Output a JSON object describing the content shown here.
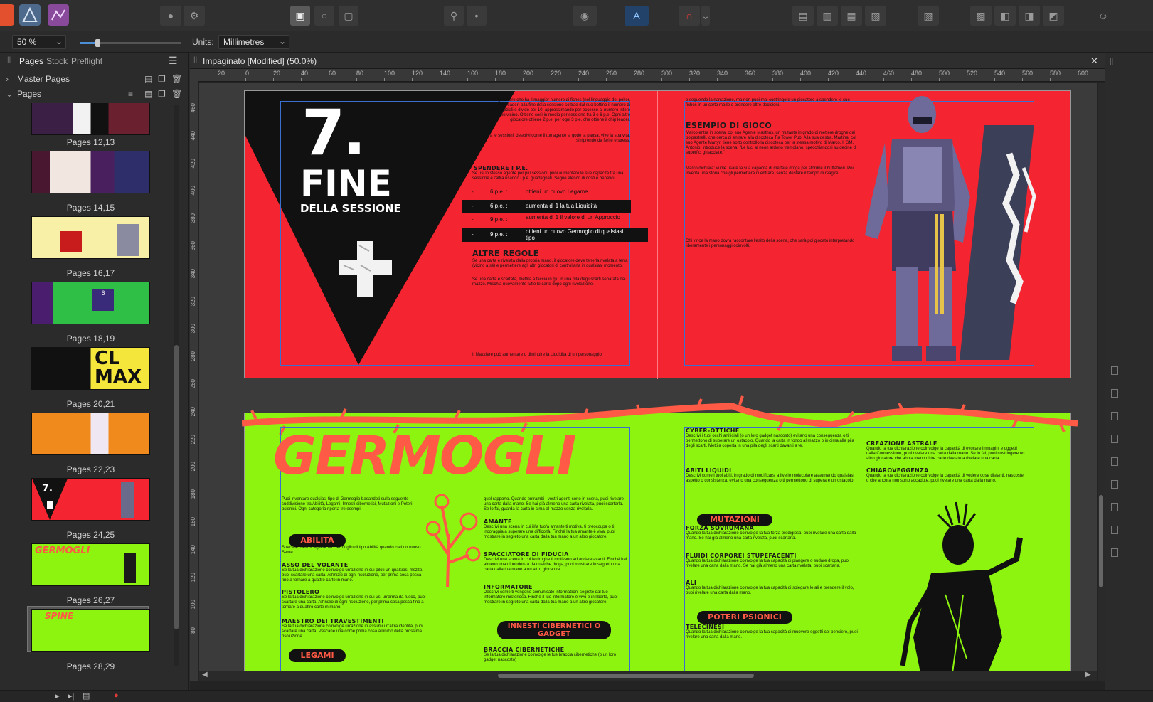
{
  "contextbar": {
    "zoom_value": "50 %",
    "units_label": "Units:",
    "units_value": "Millimetres"
  },
  "panel": {
    "tabs": [
      "Pages",
      "Stock",
      "Preflight"
    ],
    "master_pages_label": "Master Pages",
    "pages_label": "Pages",
    "thumbnails": [
      {
        "label": "Pages 12,13"
      },
      {
        "label": "Pages 14,15"
      },
      {
        "label": "Pages 16,17"
      },
      {
        "label": "Pages 18,19"
      },
      {
        "label": "Pages 20,21"
      },
      {
        "label": "Pages 22,23"
      },
      {
        "label": "Pages 24,25"
      },
      {
        "label": "Pages 26,27"
      },
      {
        "label": "Pages 28,29"
      }
    ]
  },
  "document": {
    "tab_title": "Impaginato [Modified] (50.0%)",
    "ruler_h": [
      "20",
      "0",
      "20",
      "40",
      "60",
      "80",
      "100",
      "120",
      "140",
      "160",
      "180",
      "200",
      "220",
      "240",
      "260",
      "280",
      "300",
      "320",
      "340",
      "360",
      "380",
      "400",
      "420",
      "440",
      "460",
      "480",
      "500",
      "520",
      "540",
      "560",
      "580",
      "600"
    ],
    "ruler_v": [
      "460",
      "440",
      "420",
      "400",
      "380",
      "360",
      "340",
      "320",
      "300",
      "280",
      "260",
      "240",
      "220",
      "200",
      "180",
      "160",
      "140",
      "120",
      "100",
      "80"
    ]
  },
  "spread1": {
    "big_number": "7.",
    "title_line1": "FINE",
    "title_line2": "DELLA SESSIONE",
    "intro_text": "Il giocatore che ha il maggior numero di fiches (nel linguaggio del poker, chip leader) alla fine della sessione sottrae dal suo bottino il numero di fiches iniziali e divide per 10, approssimando per eccesso al numero intero più vicino. Ottiene così in media per sessione tra 3 e 6 p.e. Ogni altro giocatore ottiene 2 p.e. per ogni 3 p.e. che ottiene il chip leader.",
    "intro_text2": "Tra le sessioni, descrivi come il tuo agente si gode la pausa, vive la sua vita, si riprende da ferite e stress.",
    "spend_heading": "SPENDERE I P.E.",
    "spend_text": "Se usi lo stesso agente per più sessioni, puoi aumentare le sue capacità tra una sessione e l'altra usando i p.e. guadagnati. Segue elenco di costi e benefici.",
    "costs": [
      {
        "cost": "6 p.e. :",
        "benefit": "ottieni un nuovo Legame"
      },
      {
        "cost": "6 p.e. :",
        "benefit": "aumenta di 1 la tua Liquidità"
      },
      {
        "cost": "9 p.e. :",
        "benefit": "aumenta di 1 il valore di un Approccio"
      },
      {
        "cost": "9 p.e. :",
        "benefit": "ottieni un nuovo Germoglio di qualsiasi tipo"
      }
    ],
    "altre_heading": "ALTRE REGOLE",
    "altre_text": "Se una carta è rivelata dalla propria mano, il giocatore deve tenerla rivelata a terra (vicino a sé) e permettere agli altri giocatori di controllarla in qualsiasi momento.",
    "altre_text2": "Se una carta è scartata, mettila a faccia in giù in una pila degli scarti separata dal mazzo. Mischia nuovamente tutte le carte dopo ogni rivelazione.",
    "altre_text3": "Il Mazziere può aumentare o diminuire la Liquidità di un personaggio",
    "right_top_text": "e seguendo la narrazione, ma non puoi mai costringere un giocatore a spendere le sue fiches in un certo modo o prendere altre decisioni.",
    "esempio_heading": "ESEMPIO DI GIOCO",
    "esempio_text": "Marco entra in scena, col suo Agente Masthus, un mutante in grado di mettere droghe dai polpastrelli, che cerca di entrare alla discoteca Tia Tower Pub. Alla sua destra, Martina, col suo Agente Martyr, tiene sotto controllo la discoteca per la stessa motivo di Marco. Il GM, Antonio, introduce la scena: \"Le luci al neon ardono tremolano, specchiandosi su decine di superfici ghiacciate.\"",
    "marco_text": "Marco dichiara: vuole usare la sua capacità di mettere droga per stordire il buttafuori. Poi inventa una storia che gli permetterà di entrare, senza destare il tempo di reagire.",
    "chi_text": "Chi vince la mano dovrà raccontare l'esito della scena, che sarà poi giocato interpretando liberamente i personaggi coinvolti."
  },
  "spread2": {
    "title": "GERMOGLI",
    "intro": "Puoi inventare qualsiasi tipo di Germoglio basandoti sulla seguente suddivisione tra Abilità, Legami, Innesti cibernetici, Mutazioni e Poteri psionici. Ogni categoria riporta tre esempi.",
    "abilita_label": "ABILITÀ",
    "abilita_text": "Speciale: devi scegliere un Germoglio di tipo Abilità quando crei un nuovo Seme.",
    "asso_heading": "ASSO DEL VOLANTE",
    "asso_text": "Se la tua dichiarazione coinvolge un'azione in cui piloti un qualsiasi mezzo, puoi scartare una carta. All'inizio di ogni risoluzione, per prima cosa pesca fino a tornare a quattro carte in mano.",
    "pistolero_heading": "PISTOLERO",
    "pistolero_text": "Se la tua dichiarazione coinvolge un'azione in cui usi un'arma da fuoco, puoi scartare una carta. All'inizio di ogni risoluzione, per prima cosa pesca fino a tornare a quattro carte in mano.",
    "maestro_heading": "MAESTRO DEI TRAVESTIMENTI",
    "maestro_text": "Se la tua dichiarazione coinvolge un'azione in assumi un'altra identità, puoi scartare una carta. Pescane una come prima cosa all'inizio della prossima risoluzione.",
    "legami_label": "LEGAMI",
    "col2_top": "quel rapporto. Quando entrambi i vostri agenti sono in scena, puoi rivelare una carta dalla mano. Se hai già almeno una carta rivelata, puoi scartarla. Se lo fai, guarda la carta in cima al mazzo senza rivelarla.",
    "amante_heading": "AMANTE",
    "amante_text": "Descrivi una scena in cui il/la tuo/a amante ti motiva, ti preoccupa o ti incoraggia a superare una difficoltà. Finché la tua amante è viva, puoi mostrare in segreto una carta dalla tua mano a un altro giocatore.",
    "spacciatore_heading": "SPACCIATORE DI FIDUCIA",
    "spacciatore_text": "Descrivi una scena in cui le droghe ti motivano ad andare avanti. Finché hai almeno una dipendenza da qualche droga, puoi mostrare in segreto una carta dalla tua mano a un altro giocatore.",
    "informatore_heading": "INFORMATORE",
    "informatore_text": "Descrivi come ti vengono comunicate informazioni segrete dal tuo informatore misterioso. Finché il tuo informatore è vivo e in libertà, puoi mostrare in segreto una carta dalla tua mano a un altro giocatore.",
    "innesti_label": "INNESTI CIBERNETICI O GADGET",
    "braccia_heading": "BRACCIA CIBERNETICHE",
    "braccia_text": "Se la tua dichiarazione coinvolge le tue braccia cibernetiche (o un loro gadget nascosto)",
    "cyber_heading": "CYBER-OTTICHE",
    "cyber_text": "Descrivi i tuoi occhi artificiali (o un loro gadget nascosto) evitano una conseguenza o ti permettono di superare un ostacolo. Quando la carta in fondo al mazzo o in cima alla pila degli scarti. Mettila coperta in una pila degli scarti davanti a te.",
    "abiti_heading": "ABITI LIQUIDI",
    "abiti_text": "Descrivi come i tuoi abiti, in grado di modificarsi a livello molecolare assumendo qualsiasi aspetto o consistenza, evitano una conseguenza o ti permettono di superare un ostacolo.",
    "mutazioni_label": "MUTAZIONI",
    "forza_heading": "FORZA SOVRUMANA",
    "forza_text": "Quando la tua dichiarazione coinvolge la tua forza prodigiosa, puoi rivelare una carta dalla mano. Se hai già almeno una carta rivelata, puoi scartarla.",
    "fluidi_heading": "FLUIDI CORPOREI STUPEFACENTI",
    "fluidi_text": "Quando la tua dichiarazione coinvolge la tua capacità di piangere o sudare droga, puoi rivelare una carta dalla mano. Se hai già almeno una carta rivelata, puoi scartarla.",
    "ali_heading": "ALI",
    "ali_text": "Quando la tua dichiarazione coinvolge la tua capacità di spiegare le ali e prendere il volo, puoi rivelare una carta dalla mano.",
    "poteri_label": "POTERI PSIONICI",
    "telecinesi_heading": "TELECINESI",
    "telecinesi_text": "Quando la tua dichiarazione coinvolge la tua capacità di muovere oggetti col pensiero, puoi rivelare una carta dalla mano.",
    "creazione_heading": "CREAZIONE ASTRALE",
    "creazione_text": "Quando la tua dichiarazione coinvolge la capacità di evocare immagini e oggetti dalla Connessione, puoi rivelare una carta dalla mano. Se lo fai, puoi costringere un altro giocatore che abbia meno di tre carte rivelate a rivelare una carta.",
    "chiaro_heading": "CHIAROVEGGENZA",
    "chiaro_text": "Quando la tua dichiarazione coinvolge la capacità di vedere cose distanti, nascoste o che ancora non sono accadute, puoi rivelare una carta dalla mano."
  },
  "colors": {
    "red_page": "#f42531",
    "green_page": "#8cf40e",
    "accent_orange": "#ff5a45",
    "panel_bg": "#2b2b2b"
  }
}
